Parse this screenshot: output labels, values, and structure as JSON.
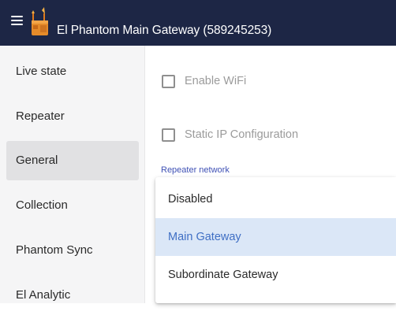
{
  "header": {
    "title": "El Phantom Main Gateway (589245253)",
    "menu_icon": "hamburger-menu-icon",
    "logo_icon": "app-logo-icon",
    "background_color": "#1d2645"
  },
  "sidebar": {
    "items": [
      {
        "label": "Live state",
        "active": false
      },
      {
        "label": "Repeater",
        "active": false
      },
      {
        "label": "General",
        "active": true
      },
      {
        "label": "Collection",
        "active": false
      },
      {
        "label": "Phantom Sync",
        "active": false
      },
      {
        "label": "El Analytic",
        "active": false
      }
    ]
  },
  "main": {
    "checkboxes": [
      {
        "label": "Enable WiFi",
        "checked": false
      },
      {
        "label": "Static IP Configuration",
        "checked": false
      }
    ],
    "repeater_network": {
      "label": "Repeater network",
      "selected": "Main Gateway",
      "options": [
        {
          "label": "Disabled",
          "selected": false
        },
        {
          "label": "Main Gateway",
          "selected": true
        },
        {
          "label": "Subordinate Gateway",
          "selected": false
        }
      ]
    }
  },
  "colors": {
    "accent": "#3f51b5",
    "selected_option_background": "#dbe7f7",
    "selected_option_text": "#3f6fc4",
    "active_nav_background": "#e1e1e3"
  }
}
